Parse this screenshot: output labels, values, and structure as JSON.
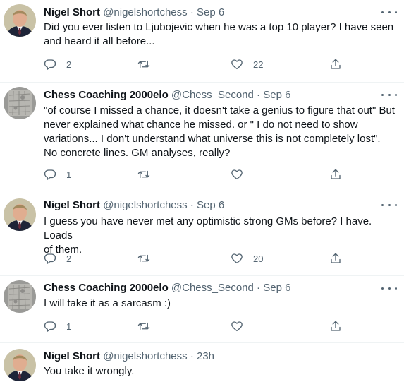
{
  "tweets": [
    {
      "name": "Nigel Short",
      "handle": "@nigelshortchess",
      "sep": "·",
      "time": "Sep 6",
      "text": "Did you ever listen to Ljubojevic when he was a top 10 player? I have seen\nand heard it all before...",
      "replies": "2",
      "retweets": "",
      "likes": "22",
      "avatar": "nigel"
    },
    {
      "name": "Chess Coaching 2000elo",
      "handle": "@Chess_Second",
      "sep": "·",
      "time": "Sep 6",
      "text": "\"of course I missed a chance, it doesn't take a genius to figure that out\" But\nnever explained what chance he missed. or \" I do not need to show\nvariations... I don't understand what universe this is not completely lost\".\nNo concrete lines. GM analyses, really?",
      "replies": "1",
      "retweets": "",
      "likes": "",
      "avatar": "coach"
    },
    {
      "name": "Nigel Short",
      "handle": "@nigelshortchess",
      "sep": "·",
      "time": "Sep 6",
      "text": "I guess you have never met any optimistic strong GMs before? I have. Loads\nof them.",
      "replies": "2",
      "retweets": "",
      "likes": "20",
      "avatar": "nigel"
    },
    {
      "name": "Chess Coaching 2000elo",
      "handle": "@Chess_Second",
      "sep": "·",
      "time": "Sep 6",
      "text": "I will take it as a sarcasm :)",
      "replies": "1",
      "retweets": "",
      "likes": "",
      "avatar": "coach"
    },
    {
      "name": "Nigel Short",
      "handle": "@nigelshortchess",
      "sep": "·",
      "time": "23h",
      "text": "You take it wrongly.",
      "avatar": "nigel"
    }
  ],
  "icons": {
    "reply": "reply-icon",
    "retweet": "retweet-icon",
    "like": "heart-icon",
    "share": "share-icon",
    "more": "more-icon"
  },
  "colors": {
    "text": "#0f1419",
    "secondary": "#536471",
    "divider": "#eff3f4"
  }
}
